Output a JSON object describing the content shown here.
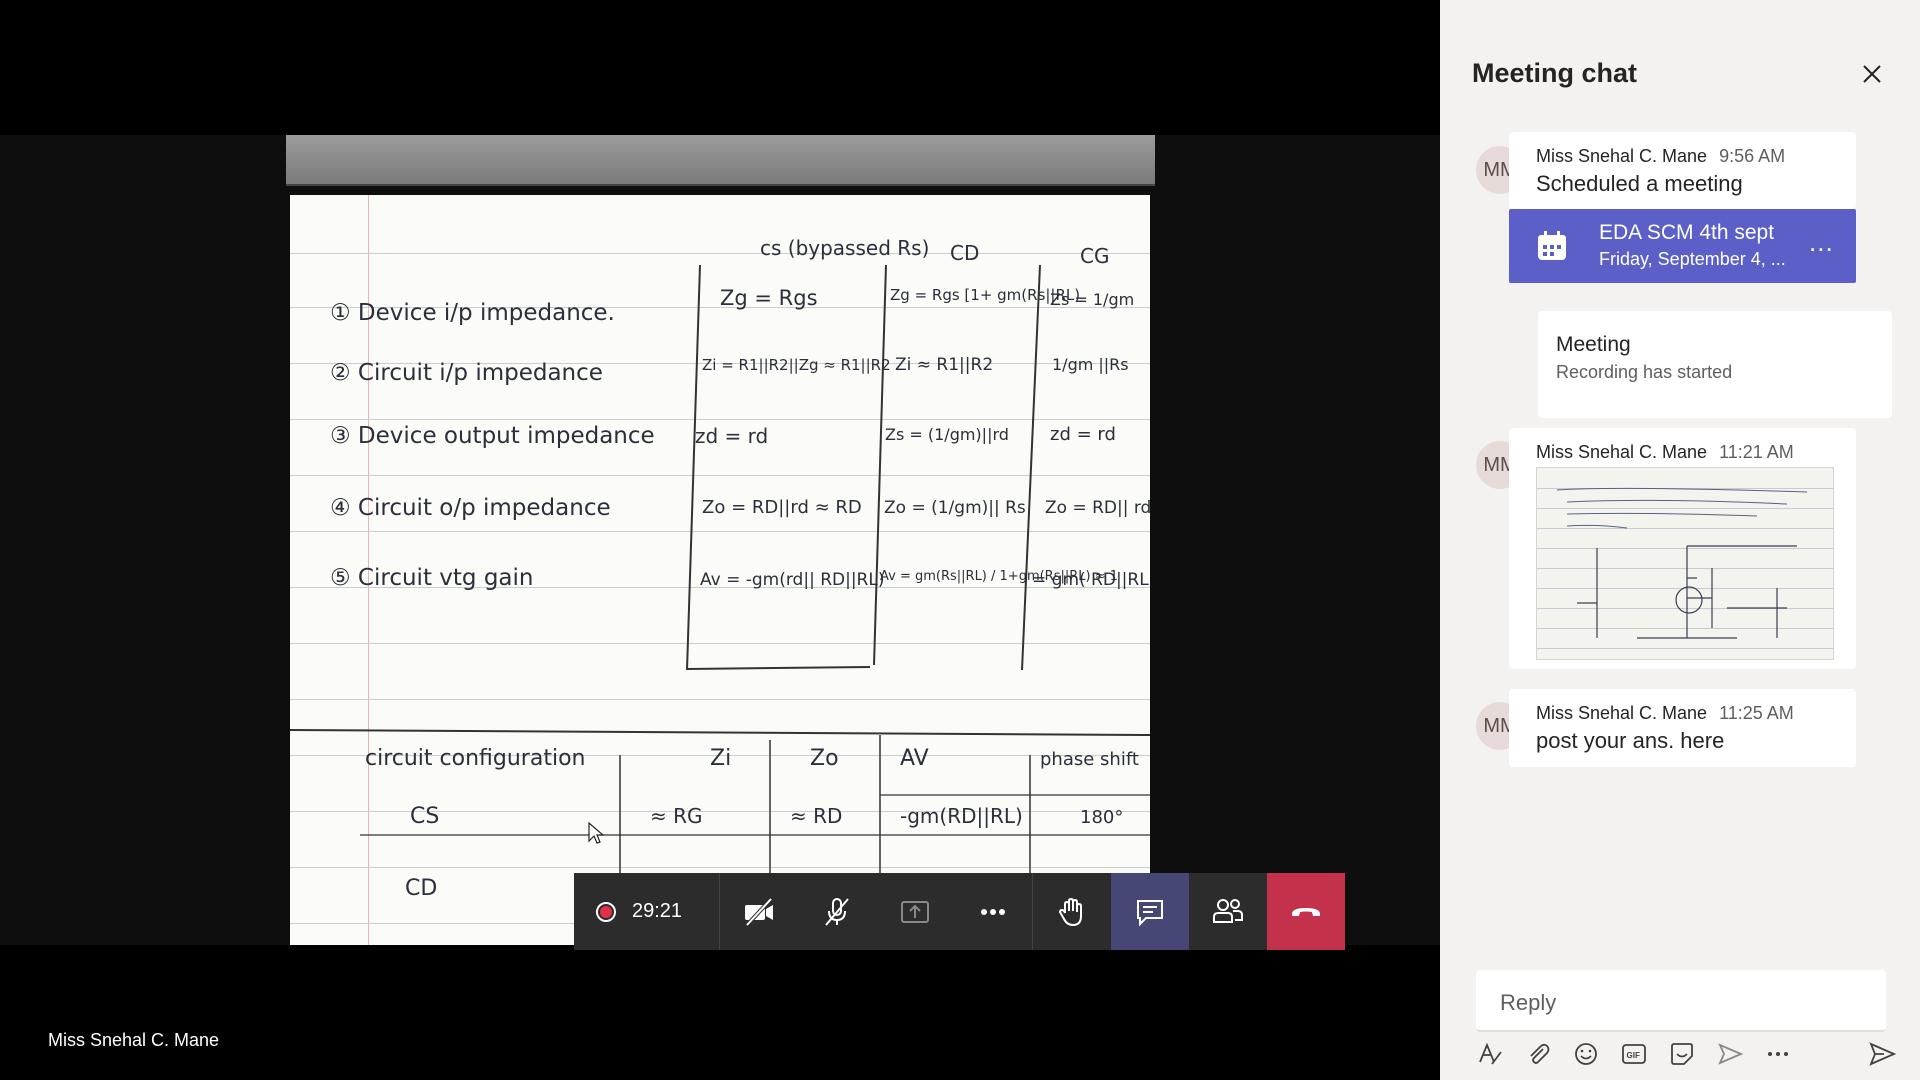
{
  "stage": {
    "presenter_name": "Miss Snehal C. Mane",
    "paper": {
      "header": [
        "cs (bypassed Rs)",
        "CD",
        "CG"
      ],
      "rows": [
        {
          "label": "① Device i/p impedance.",
          "cs": "Zg = Rgs",
          "cd": "Zg = Rgs [1+ gm(Rs||RL)",
          "cg": "Zs = 1/gm"
        },
        {
          "label": "② Circuit i/p impedance",
          "cs": "Zi = R1||R2||Zg ≈ R1||R2",
          "cd": "Zi ≈ R1||R2",
          "cg": "1/gm ||Rs"
        },
        {
          "label": "③ Device output impedance",
          "cs": "zd = rd",
          "cd": "Zs = (1/gm)||rd",
          "cg": "zd = rd"
        },
        {
          "label": "④ Circuit o/p impedance",
          "cs": "Zo = RD||rd ≈ RD",
          "cd": "Zo = (1/gm)|| Rs",
          "cg": "Zo = RD|| rd"
        },
        {
          "label": "⑤ Circuit vtg gain",
          "cs": "Av = -gm(rd|| RD||RL)",
          "cd": "Av = gm(Rs||RL) / 1+gm(Rs||RL) ≈ 1",
          "cg": "= gm( RD||RL)"
        }
      ],
      "table2_header": [
        "circuit configuration",
        "Zi",
        "Zo",
        "AV",
        "phase shift"
      ],
      "table2_rows": [
        [
          "CS",
          "≈ RG",
          "≈ RD",
          "-gm(RD||RL)",
          "180°"
        ],
        [
          "CD",
          "",
          "",
          "",
          ""
        ]
      ]
    }
  },
  "toolbar": {
    "timer": "29:21"
  },
  "chat": {
    "title": "Meeting chat",
    "messages": [
      {
        "initials": "MM",
        "sender": "Miss Snehal C. Mane",
        "time": "9:56 AM",
        "text": "Scheduled a meeting"
      },
      {
        "initials": "MM",
        "sender": "Miss Snehal C. Mane",
        "time": "11:21 AM",
        "text": ""
      },
      {
        "initials": "MM",
        "sender": "Miss Snehal C. Mane",
        "time": "11:25 AM",
        "text": "post your ans. here"
      }
    ],
    "meeting_card": {
      "title": "EDA SCM 4th sept",
      "subtitle": "Friday, September 4, ...",
      "more": "..."
    },
    "event": {
      "title": "Meeting",
      "subtitle": "Recording has started"
    },
    "reply_placeholder": "Reply"
  },
  "colors": {
    "accent": "#5b5fc7",
    "hangup": "#c4314b",
    "record": "#e0304c",
    "panel_bg": "#f3f2f1"
  }
}
